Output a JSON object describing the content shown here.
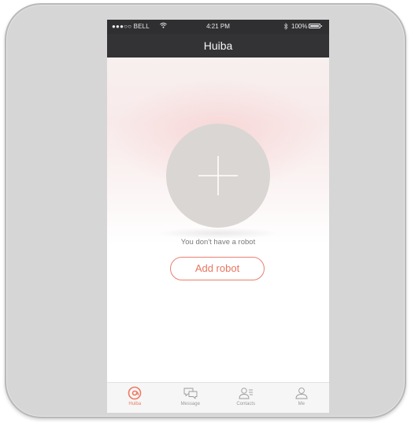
{
  "status_bar": {
    "carrier": "●●●○○ BELL",
    "time": "4:21 PM",
    "battery": "100%",
    "wifi_icon": "wifi-icon",
    "bluetooth_icon": "bluetooth-icon"
  },
  "nav": {
    "title": "Huiba"
  },
  "main": {
    "add_icon": "plus-icon",
    "empty_message": "You don't have a robot",
    "add_button_label": "Add robot"
  },
  "tabs": [
    {
      "label": "Huiba",
      "icon": "huiba-swirl-icon",
      "active": true
    },
    {
      "label": "Message",
      "icon": "chat-bubbles-icon",
      "active": false
    },
    {
      "label": "Contacts",
      "icon": "contacts-icon",
      "active": false
    },
    {
      "label": "Me",
      "icon": "person-icon",
      "active": false
    }
  ],
  "colors": {
    "accent": "#ec7a62",
    "header_bg": "#333336",
    "frame_bg": "#d6d6d6",
    "circle_bg": "#d9d6d3"
  }
}
